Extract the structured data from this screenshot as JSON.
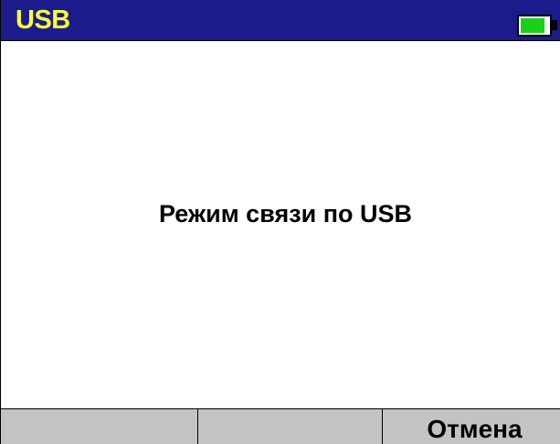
{
  "titlebar": {
    "title": "USB",
    "battery_icon": "battery-icon",
    "battery_level": 0.85,
    "title_color": "#ffff33",
    "bar_color": "#1b1b8c",
    "battery_color": "#19d119"
  },
  "content": {
    "message": "Режим связи по USB"
  },
  "softkeys": [
    {
      "label": ""
    },
    {
      "label": ""
    },
    {
      "label": "Отмена"
    }
  ]
}
